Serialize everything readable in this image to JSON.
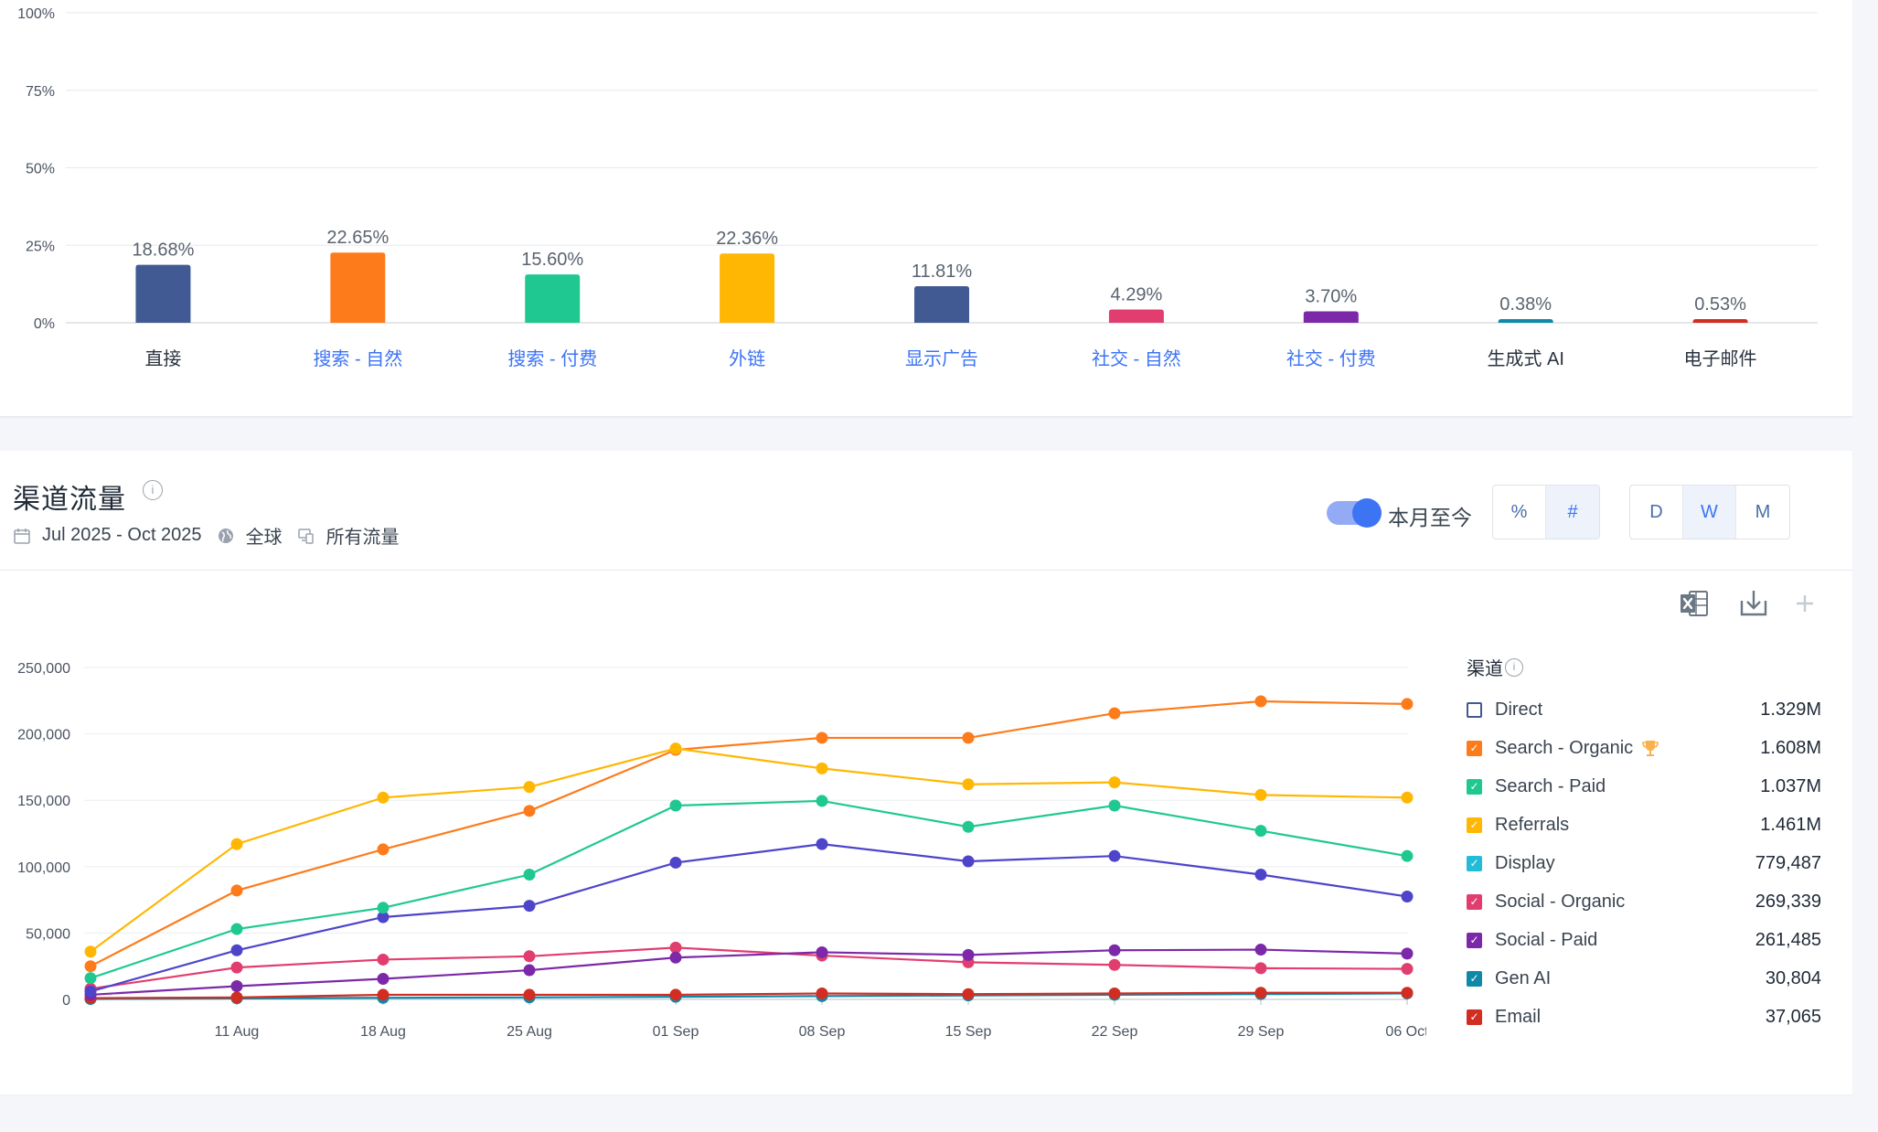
{
  "share_chart": {
    "y_ticks": [
      "100%",
      "75%",
      "50%",
      "25%",
      "0%"
    ],
    "bars": [
      {
        "label": "直接",
        "value": 18.68,
        "value_label": "18.68%",
        "color": "#415a93",
        "link": false
      },
      {
        "label": "搜索 - 自然",
        "value": 22.65,
        "value_label": "22.65%",
        "color": "#fd7b1a",
        "link": true
      },
      {
        "label": "搜索 - 付费",
        "value": 15.6,
        "value_label": "15.60%",
        "color": "#1fc891",
        "link": true
      },
      {
        "label": "外链",
        "value": 22.36,
        "value_label": "22.36%",
        "color": "#ffb703",
        "link": true
      },
      {
        "label": "显示广告",
        "value": 11.81,
        "value_label": "11.81%",
        "color": "#415a93",
        "link": true
      },
      {
        "label": "社交 - 自然",
        "value": 4.29,
        "value_label": "4.29%",
        "color": "#e13e6f",
        "link": true
      },
      {
        "label": "社交 - 付费",
        "value": 3.7,
        "value_label": "3.70%",
        "color": "#7c29a9",
        "link": true
      },
      {
        "label": "生成式 AI",
        "value": 0.38,
        "value_label": "0.38%",
        "color": "#0e8aa8",
        "link": false
      },
      {
        "label": "电子邮件",
        "value": 0.53,
        "value_label": "0.53%",
        "color": "#d12d23",
        "link": false
      }
    ]
  },
  "channel_traffic": {
    "title": "渠道流量",
    "date_range": "Jul 2025 - Oct 2025",
    "region": "全球",
    "traffic_type": "所有流量",
    "toggle_label": "本月至今",
    "toggle_on": true,
    "mode_buttons": [
      {
        "label": "%",
        "active": false
      },
      {
        "label": "#",
        "active": true
      }
    ],
    "granularity_buttons": [
      {
        "label": "D",
        "active": false
      },
      {
        "label": "W",
        "active": true
      },
      {
        "label": "M",
        "active": false
      }
    ],
    "icons": [
      "info-icon",
      "calendar-icon",
      "globe-icon",
      "devices-icon",
      "excel-icon",
      "download-icon",
      "plus-icon"
    ],
    "legend": {
      "title": "渠道",
      "items": [
        {
          "name": "Direct",
          "value": "1.329M",
          "color": "#415a93",
          "checked": false
        },
        {
          "name": "Search - Organic",
          "value": "1.608M",
          "color": "#fd7b1a",
          "checked": true,
          "badge": "trophy-icon"
        },
        {
          "name": "Search - Paid",
          "value": "1.037M",
          "color": "#1fc891",
          "checked": true
        },
        {
          "name": "Referrals",
          "value": "1.461M",
          "color": "#ffb703",
          "checked": true
        },
        {
          "name": "Display",
          "value": "779,487",
          "color": "#22bcd8",
          "checked": true
        },
        {
          "name": "Social - Organic",
          "value": "269,339",
          "color": "#e13e6f",
          "checked": true
        },
        {
          "name": "Social - Paid",
          "value": "261,485",
          "color": "#7c29a9",
          "checked": true
        },
        {
          "name": "Gen AI",
          "value": "30,804",
          "color": "#0e8aa8",
          "checked": true
        },
        {
          "name": "Email",
          "value": "37,065",
          "color": "#d12d23",
          "checked": true
        }
      ]
    }
  },
  "chart_data": [
    {
      "type": "bar",
      "categories": [
        "直接",
        "搜索 - 自然",
        "搜索 - 付费",
        "外链",
        "显示广告",
        "社交 - 自然",
        "社交 - 付费",
        "生成式 AI",
        "电子邮件"
      ],
      "values": [
        18.68,
        22.65,
        15.6,
        22.36,
        11.81,
        4.29,
        3.7,
        0.38,
        0.53
      ],
      "ylim": [
        0,
        100
      ],
      "grid": true
    },
    {
      "type": "line",
      "x_ticks": [
        "11 Aug",
        "18 Aug",
        "25 Aug",
        "01 Sep",
        "08 Sep",
        "15 Sep",
        "22 Sep",
        "29 Sep",
        "06 Oct"
      ],
      "x": [
        "04 Aug",
        "11 Aug",
        "18 Aug",
        "25 Aug",
        "01 Sep",
        "08 Sep",
        "15 Sep",
        "22 Sep",
        "29 Sep",
        "06 Oct"
      ],
      "y_ticks": [
        "250,000",
        "200,000",
        "150,000",
        "100,000",
        "50,000",
        "0"
      ],
      "ylim": [
        0,
        250000
      ],
      "grid": true,
      "legend_position": "right",
      "series": [
        {
          "name": "Referrals",
          "color": "#ffb703",
          "values": [
            36000,
            117000,
            152000,
            160000,
            189000,
            174000,
            162000,
            163500,
            154000,
            152000
          ]
        },
        {
          "name": "Search - Organic",
          "color": "#fd7b1a",
          "values": [
            25000,
            82000,
            113000,
            142000,
            188000,
            197000,
            197000,
            215500,
            224500,
            222500
          ]
        },
        {
          "name": "Search - Paid",
          "color": "#1fc891",
          "values": [
            16000,
            53000,
            69000,
            94000,
            146000,
            149500,
            130000,
            146000,
            127000,
            108000
          ]
        },
        {
          "name": "Display",
          "color": "#4e44c9",
          "values": [
            6000,
            37000,
            62000,
            70500,
            103000,
            117000,
            104000,
            108000,
            94000,
            77500
          ]
        },
        {
          "name": "Social - Organic",
          "color": "#e13e6f",
          "values": [
            8000,
            24000,
            30000,
            32500,
            39000,
            33000,
            28000,
            26000,
            23500,
            23000
          ]
        },
        {
          "name": "Social - Paid",
          "color": "#7c29a9",
          "values": [
            3500,
            10000,
            15500,
            22000,
            31500,
            35500,
            33500,
            37000,
            37500,
            34500
          ]
        },
        {
          "name": "Gen AI",
          "color": "#0e8aa8",
          "values": [
            300,
            800,
            1200,
            1500,
            2000,
            2500,
            3000,
            3500,
            4000,
            4500
          ]
        },
        {
          "name": "Email",
          "color": "#d12d23",
          "values": [
            1000,
            1500,
            3500,
            3500,
            3500,
            4500,
            4000,
            4500,
            5000,
            5000
          ]
        }
      ]
    }
  ]
}
